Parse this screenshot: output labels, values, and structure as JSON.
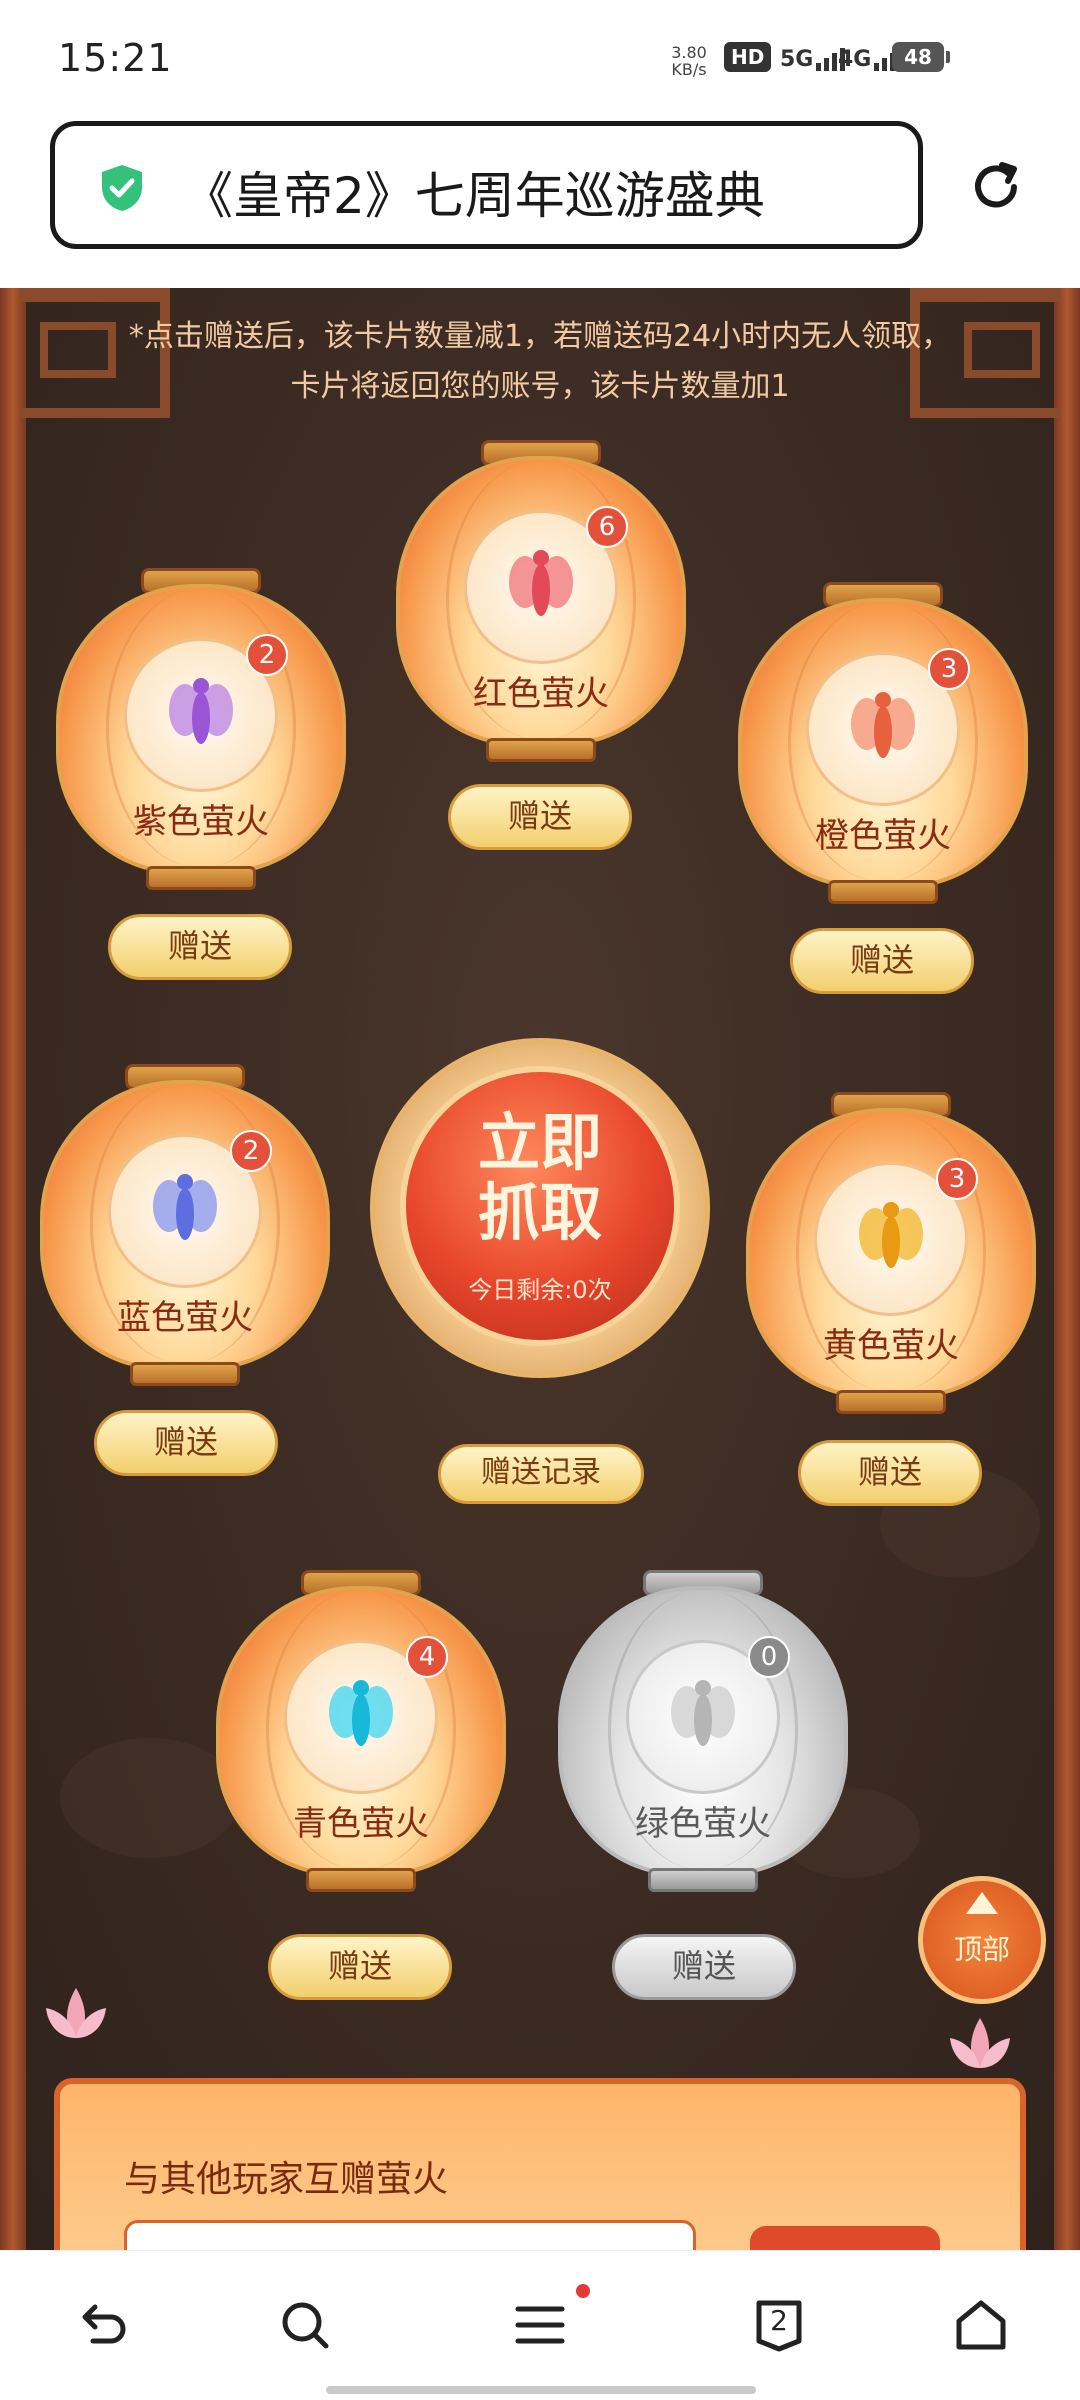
{
  "status_bar": {
    "time": "15:21",
    "net_speed_value": "3.80",
    "net_speed_unit": "KB/s",
    "hd_label": "HD",
    "net1": "5G",
    "net2": "4G",
    "battery": "48"
  },
  "browser": {
    "page_title": "《皇帝2》七周年巡游盛典",
    "tab_count": "2"
  },
  "event": {
    "notice": "*点击赠送后，该卡片数量减1，若赠送码24小时内无人领取，卡片将返回您的账号，该卡片数量加1",
    "grab_button": {
      "title_line1": "立即",
      "title_line2": "抓取",
      "remaining": "今日剩余:0次"
    },
    "record_button": "赠送记录",
    "top_button": "顶部",
    "fireflies": [
      {
        "name": "紫色萤火",
        "count": "2",
        "give": "赠送",
        "color": "#b57ae6",
        "enabled": true
      },
      {
        "name": "红色萤火",
        "count": "6",
        "give": "赠送",
        "color": "#ef6b74",
        "enabled": true
      },
      {
        "name": "橙色萤火",
        "count": "3",
        "give": "赠送",
        "color": "#f38a6a",
        "enabled": true
      },
      {
        "name": "蓝色萤火",
        "count": "2",
        "give": "赠送",
        "color": "#7f8ef0",
        "enabled": true
      },
      {
        "name": "黄色萤火",
        "count": "3",
        "give": "赠送",
        "color": "#f2b62a",
        "enabled": true
      },
      {
        "name": "青色萤火",
        "count": "4",
        "give": "赠送",
        "color": "#3fd6f0",
        "enabled": true
      },
      {
        "name": "绿色萤火",
        "count": "0",
        "give": "赠送",
        "color": "#cfcfcf",
        "enabled": false
      }
    ],
    "panel_title": "与其他玩家互赠萤火"
  },
  "colors": {
    "accent": "#e4513a",
    "shield": "#34c17a"
  }
}
